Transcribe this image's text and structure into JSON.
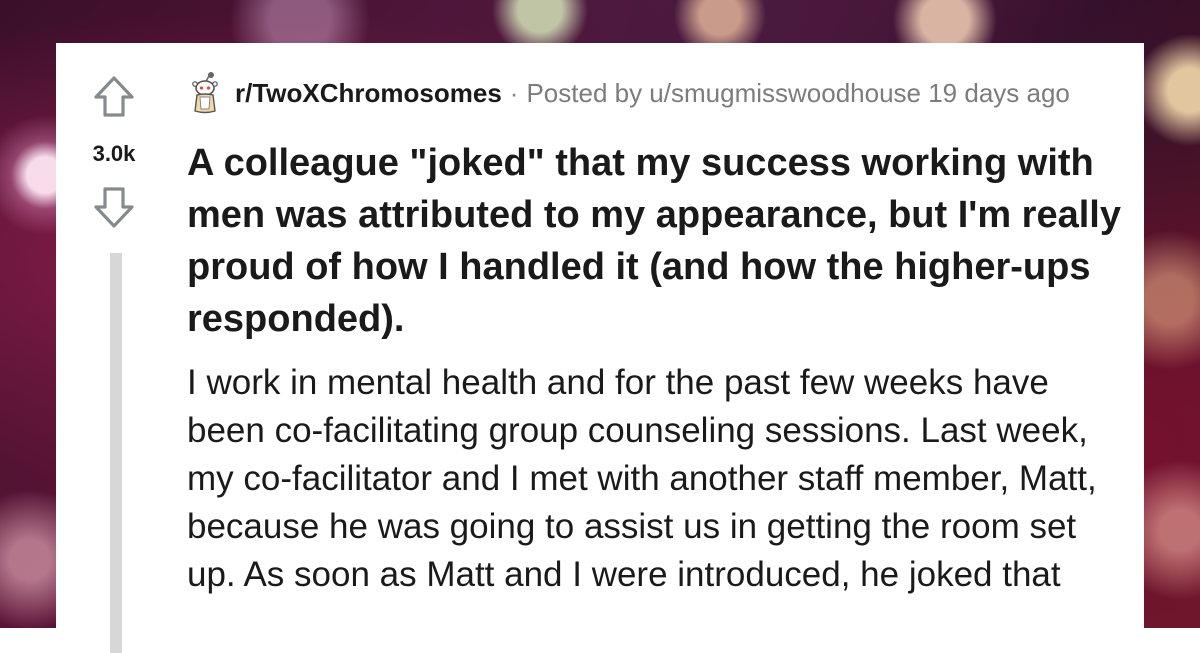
{
  "post": {
    "score": "3.0k",
    "subreddit": "r/TwoXChromosomes",
    "separator": "·",
    "posted_by": "Posted by u/smugmisswoodhouse 19 days ago",
    "title": "A colleague \"joked\" that my success working with men was attributed to my appearance, but I'm really proud of how I handled it (and how the higher-ups responded).",
    "body": "I work in mental health and for the past few weeks have been co-facilitating group counseling sessions. Last week, my co-facilitator and I met with another staff member, Matt, because he was going to assist us in getting the room set up. As soon as Matt and I were introduced, he joked that"
  },
  "icons": {
    "upvote": "upvote-arrow-icon",
    "downvote": "downvote-arrow-icon",
    "subreddit": "snoo-avatar-icon"
  },
  "colors": {
    "card_background": "#ffffff",
    "text": "#1a1a1b",
    "meta_text": "#7c7c7c",
    "arrow_stroke": "#878a8c",
    "thread_line": "#d7d7d7"
  }
}
